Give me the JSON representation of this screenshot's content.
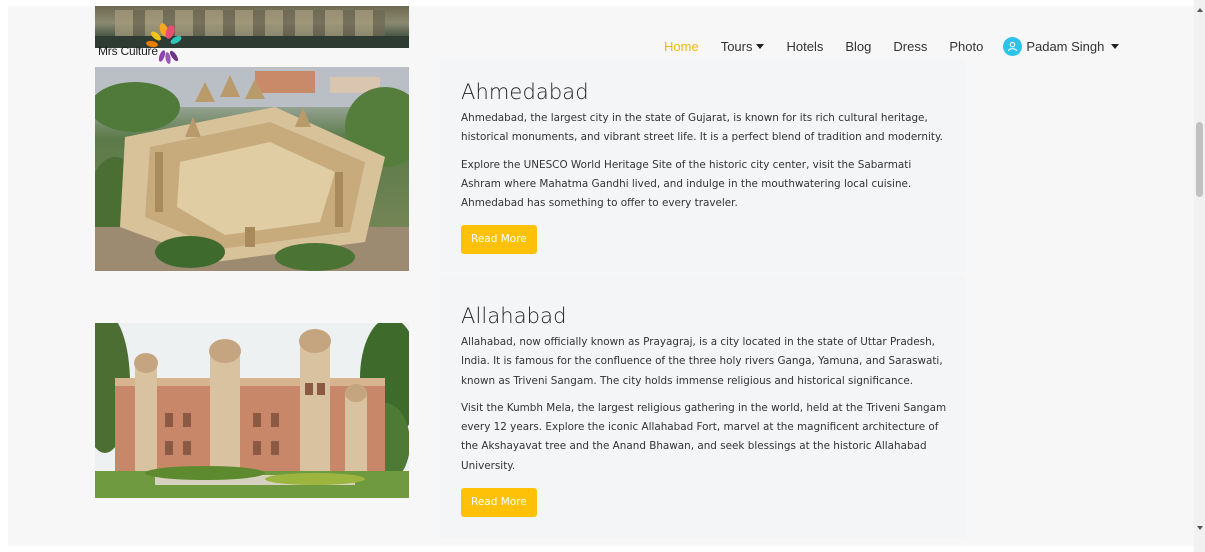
{
  "brand": {
    "name": "Mrs Culture"
  },
  "nav": {
    "items": [
      {
        "label": "Home",
        "active": true
      },
      {
        "label": "Tours",
        "dropdown": true
      },
      {
        "label": "Hotels"
      },
      {
        "label": "Blog"
      },
      {
        "label": "Dress"
      },
      {
        "label": "Photo"
      }
    ],
    "user_name": "Padam Singh",
    "active_color": "#f5b800"
  },
  "cities": [
    {
      "title": "Ahmedabad",
      "paragraphs": [
        "Ahmedabad, the largest city in the state of Gujarat, is known for its rich cultural heritage, historical monuments, and vibrant street life. It is a perfect blend of tradition and modernity.",
        "Explore the UNESCO World Heritage Site of the historic city center, visit the Sabarmati Ashram where Mahatma Gandhi lived, and indulge in the mouthwatering local cuisine. Ahmedabad has something to offer to every traveler."
      ],
      "button_label": "Read More"
    },
    {
      "title": "Allahabad",
      "paragraphs": [
        "Allahabad, now officially known as Prayagraj, is a city located in the state of Uttar Pradesh, India. It is famous for the confluence of the three holy rivers Ganga, Yamuna, and Saraswati, known as Triveni Sangam. The city holds immense religious and historical significance.",
        "Visit the Kumbh Mela, the largest religious gathering in the world, held at the Triveni Sangam every 12 years. Explore the iconic Allahabad Fort, marvel at the magnificent architecture of the Akshayavat tree and the Anand Bhawan, and seek blessings at the historic Allahabad University."
      ],
      "button_label": "Read More"
    }
  ],
  "colors": {
    "button": "#ffc107",
    "avatar": "#2ec4e9"
  }
}
